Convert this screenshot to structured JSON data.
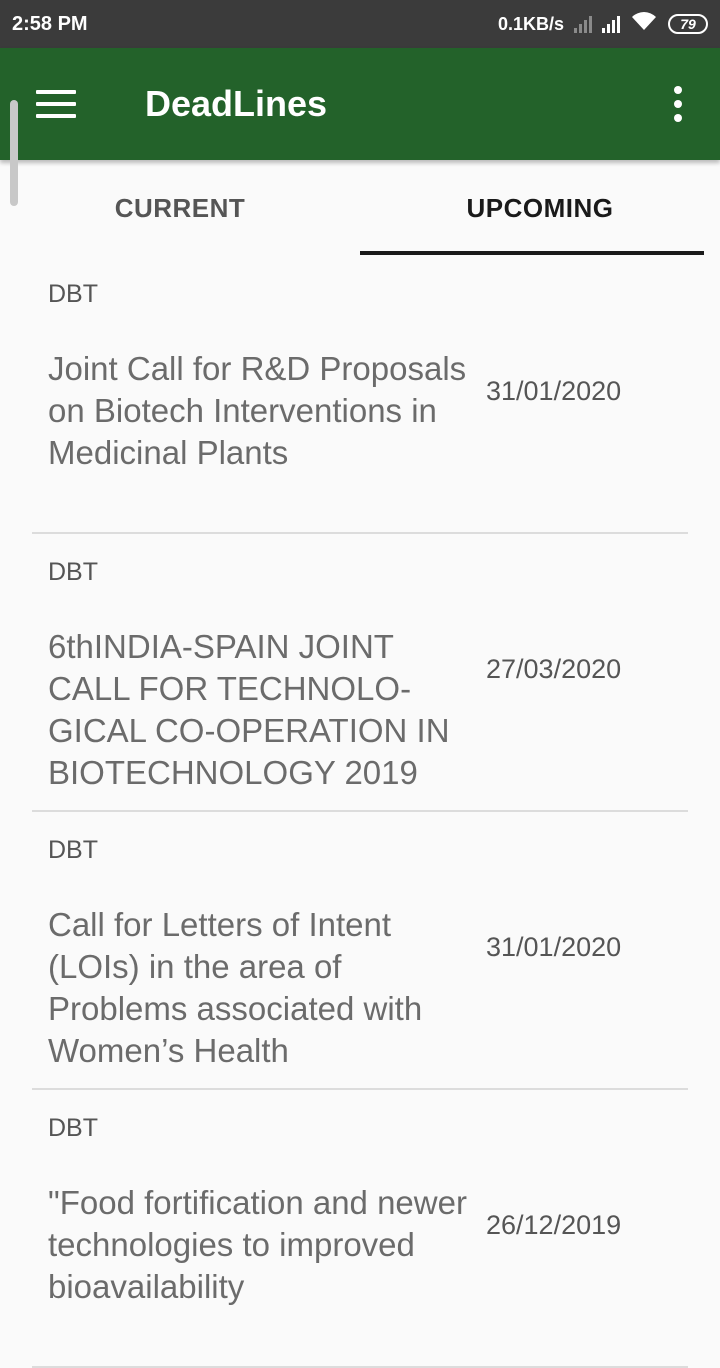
{
  "status_bar": {
    "time": "2:58 PM",
    "net_speed": "0.1KB/s",
    "battery": "79",
    "icons": [
      "signal-icon",
      "wifi-icon",
      "battery-icon"
    ]
  },
  "app_bar": {
    "title": "DeadLines",
    "color": "#23622a"
  },
  "tabs": [
    {
      "label": "CURRENT",
      "selected": false
    },
    {
      "label": "UPCOMING",
      "selected": true
    }
  ],
  "deadlines": [
    {
      "agency": "DBT",
      "title": "Joint Call for R&D Proposals on Biotech Interventions in Medicinal Plants",
      "date": "31/01/2020"
    },
    {
      "agency": "DBT",
      "title": "6thINDIA-SPAIN JOINT CALL FOR TECHNOLO-GICAL CO-OPERATION IN BIOTECHNOLOGY 2019",
      "date": "27/03/2020"
    },
    {
      "agency": "DBT",
      "title": "Call for Letters of Intent (LOIs) in the area of Problems associated with Women’s Health",
      "date": "31/01/2020"
    },
    {
      "agency": "DBT",
      "title": "\"Food fortification and newer technologies to improved bioavailability",
      "date": "26/12/2019"
    }
  ]
}
